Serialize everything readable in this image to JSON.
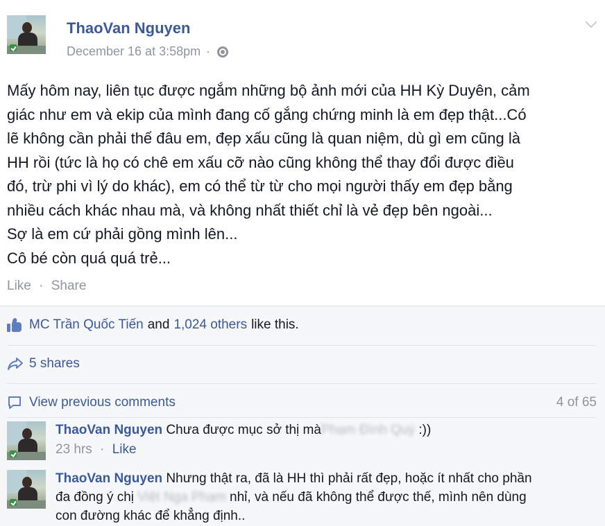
{
  "post": {
    "author": "ThaoVan Nguyen",
    "timestamp": "December 16 at 3:58pm",
    "separator": "·",
    "body_lines": [
      "Mấy hôm nay, liên tục được ngắm những bộ ảnh mới của HH Kỳ Duyên, cảm",
      "giác như em và ekip của mình đang cố gắng chứng minh là em đẹp thật...Có",
      "lẽ không cần phải thế đâu em, đẹp xấu cũng là quan niệm, dù gì em cũng là",
      "HH rồi (tức là họ có chê em xấu cỡ nào cũng không thể thay đổi được điều",
      "đó, trừ phi vì lý do khác), em có thể từ từ cho mọi người thấy em đẹp bằng",
      "nhiều cách khác nhau mà, và không nhất thiết chỉ là vẻ đẹp bên ngoài...",
      "Sợ là em cứ phải gồng mình lên...",
      "Cô bé còn quá quá trẻ..."
    ],
    "actions": {
      "like": "Like",
      "share": "Share"
    }
  },
  "feedback": {
    "likes": {
      "first_liker": "MC Trần Quốc Tiến",
      "and": "and",
      "others": "1,024 others",
      "suffix": "like this."
    },
    "shares": "5 shares",
    "view_previous": "View previous comments",
    "pager": "4 of 65"
  },
  "comments": [
    {
      "author": "ThaoVan Nguyen",
      "text_before": "Chưa được mục sở thị mà",
      "blurred": "Phạm Đình Quý",
      "text_after": " :))",
      "time": "23 hrs",
      "like": "Like"
    },
    {
      "author": "ThaoVan Nguyen",
      "line1": "Nhưng thật ra, đã là HH thì phải rất đẹp, hoặc ít nhất cho phần",
      "line2_before": "đa đồng ý chị ",
      "blurred": "Việt Nga Phạm",
      "line2_after": " nhỉ, và nếu đã không thể được thế, mình nên dùng",
      "line3": "con đường khác để khẳng định.."
    }
  ],
  "icons": {
    "chevron": "chevron-down-icon",
    "audience": "globe-icon",
    "like": "like-icon",
    "share": "share-icon",
    "comment": "comment-icon"
  },
  "colors": {
    "link": "#3b5998",
    "muted": "#90949c",
    "text": "#141823",
    "feedback_bg": "#f6f7f9"
  }
}
